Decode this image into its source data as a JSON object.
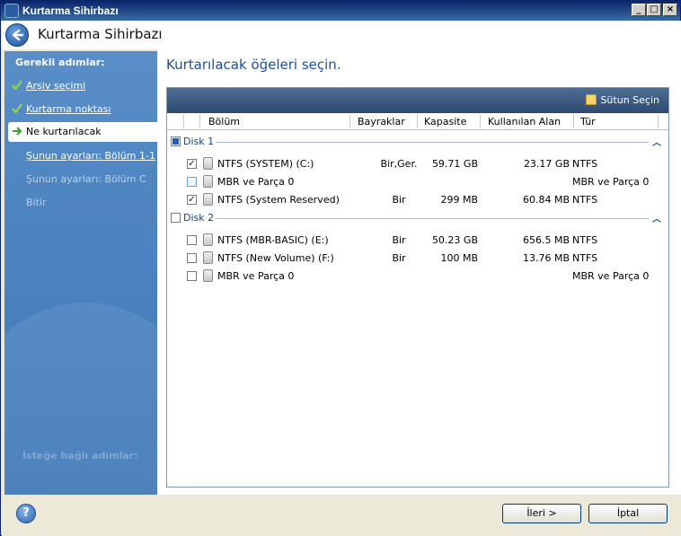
{
  "window": {
    "title": "Kurtarma Sihirbazı"
  },
  "header": {
    "title": "Kurtarma Sihirbazı"
  },
  "sidebar": {
    "heading": "Gerekli adımlar:",
    "items": [
      {
        "label": "Arşiv seçimi",
        "state": "done"
      },
      {
        "label": "Kurtarma noktası",
        "state": "done"
      },
      {
        "label": "Ne kurtarılacak",
        "state": "active"
      },
      {
        "label": "Şunun ayarları: Bölüm 1-1",
        "state": "link"
      },
      {
        "label": "Şunun ayarları: Bölüm C",
        "state": "disabled"
      },
      {
        "label": "Bitir",
        "state": "disabled"
      }
    ],
    "footer": "İsteğe bağlı adımlar:"
  },
  "main": {
    "title": "Kurtarılacak öğeleri seçin.",
    "toolbar": {
      "column_select": "Sütun Seçin"
    },
    "columns": [
      "Bölüm",
      "Bayraklar",
      "Kapasite",
      "Kullanılan Alan",
      "Tür"
    ],
    "groups": [
      {
        "label": "Disk 1",
        "rows": [
          {
            "name": "NTFS (SYSTEM) (C:)",
            "flags": "Bir,Ger.",
            "capacity": "59.71 GB",
            "used": "23.17 GB",
            "type": "NTFS",
            "checked": true
          },
          {
            "name": "MBR ve Parça 0",
            "flags": "",
            "capacity": "",
            "used": "",
            "type": "MBR ve Parça 0",
            "checked": false
          },
          {
            "name": "NTFS (System Reserved)",
            "flags": "Bir",
            "capacity": "299 MB",
            "used": "60.84 MB",
            "type": "NTFS",
            "checked": true
          }
        ]
      },
      {
        "label": "Disk 2",
        "rows": [
          {
            "name": "NTFS (MBR-BASIC) (E:)",
            "flags": "Bir",
            "capacity": "50.23 GB",
            "used": "656.5 MB",
            "type": "NTFS",
            "checked": false
          },
          {
            "name": "NTFS (New Volume) (F:)",
            "flags": "Bir",
            "capacity": "100 MB",
            "used": "13.76 MB",
            "type": "NTFS",
            "checked": false
          },
          {
            "name": "MBR ve Parça 0",
            "flags": "",
            "capacity": "",
            "used": "",
            "type": "MBR ve Parça 0",
            "checked": false
          }
        ]
      }
    ]
  },
  "buttons": {
    "next": "İleri >",
    "cancel": "İptal",
    "help": "?"
  },
  "colors": {
    "accent": "#1a4f9e",
    "sidebar": "#4f86c2",
    "toolbar": "#2d4a72"
  }
}
